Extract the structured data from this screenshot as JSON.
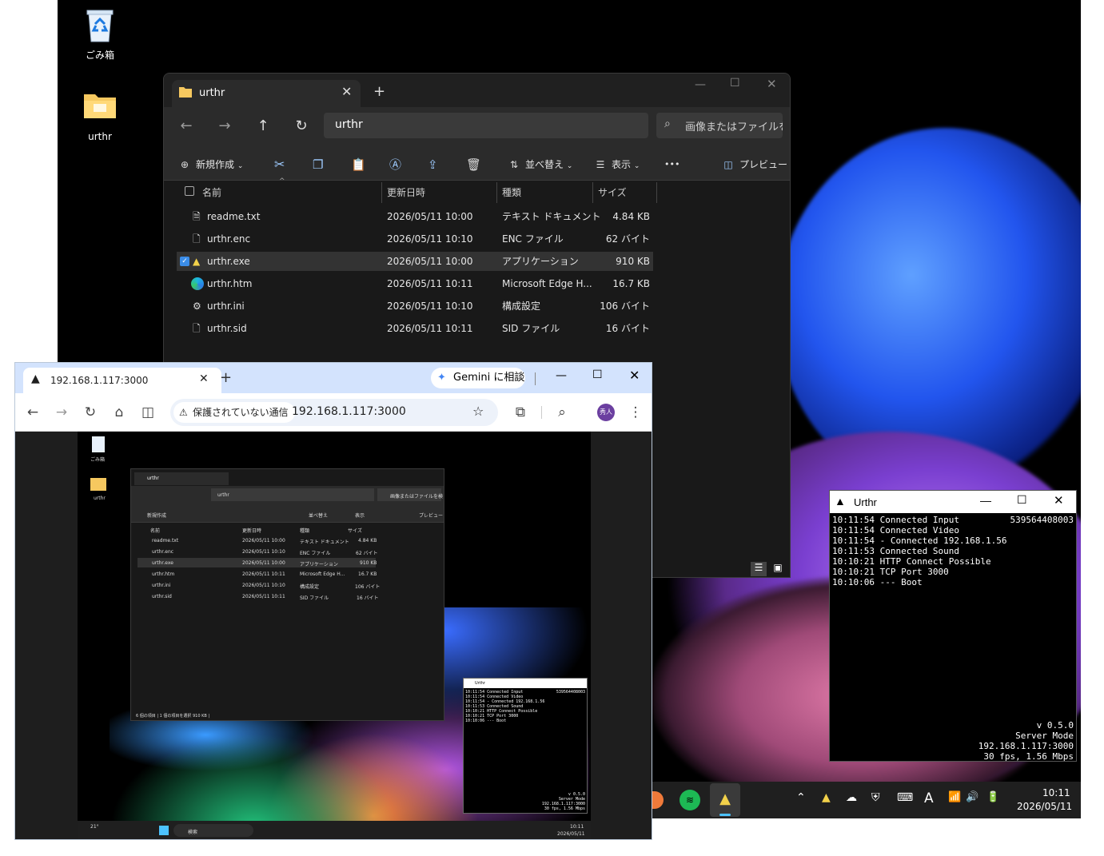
{
  "desktop": {
    "icons": [
      {
        "label": "ごみ箱",
        "icon": "recycle-bin-icon"
      },
      {
        "label": "urthr",
        "icon": "folder-icon"
      }
    ]
  },
  "explorer": {
    "tab_title": "urthr",
    "address": "urthr",
    "search_placeholder": "画像またはファイルを検",
    "commands": {
      "new": "新規作成",
      "sort": "並べ替え",
      "view": "表示",
      "more": "•••",
      "preview": "プレビュー"
    },
    "columns": {
      "name": "名前",
      "modified": "更新日時",
      "type": "種類",
      "size": "サイズ"
    },
    "files": [
      {
        "name": "readme.txt",
        "modified": "2026/05/11 10:00",
        "type": "テキスト ドキュメント",
        "size": "4.84 KB"
      },
      {
        "name": "urthr.enc",
        "modified": "2026/05/11 10:10",
        "type": "ENC ファイル",
        "size": "62 バイト"
      },
      {
        "name": "urthr.exe",
        "modified": "2026/05/11 10:00",
        "type": "アプリケーション",
        "size": "910 KB"
      },
      {
        "name": "urthr.htm",
        "modified": "2026/05/11 10:11",
        "type": "Microsoft Edge H...",
        "size": "16.7 KB"
      },
      {
        "name": "urthr.ini",
        "modified": "2026/05/11 10:10",
        "type": "構成設定",
        "size": "106 バイト"
      },
      {
        "name": "urthr.sid",
        "modified": "2026/05/11 10:11",
        "type": "SID ファイル",
        "size": "16 バイト"
      }
    ],
    "status": "6 個の項目 | 1 個の項目を選択 910 KB |"
  },
  "urthr_window": {
    "title": "Urthr",
    "id": "539564408003",
    "log": [
      "10:11:54 Connected Input",
      "10:11:54 Connected Video",
      "10:11:54 - Connected 192.168.1.56",
      "10:11:53 Connected Sound",
      "10:10:21 HTTP Connect Possible",
      "10:10:21 TCP Port 3000",
      "10:10:06 --- Boot"
    ],
    "footer": [
      "v 0.5.0",
      "Server Mode",
      "192.168.1.117:3000",
      "30 fps, 1.56 Mbps"
    ]
  },
  "taskbar": {
    "time": "10:11",
    "date": "2026/05/11",
    "ime": "A"
  },
  "browser": {
    "tab_title": "192.168.1.117:3000",
    "gemini_label": "Gemini に相談",
    "security_label": "保護されていない通信",
    "url": "192.168.1.117:3000",
    "avatar_text": "秀人"
  },
  "mini_taskbar": {
    "weather": "21°",
    "search": "検索",
    "time": "10:11",
    "date": "2026/05/11"
  }
}
